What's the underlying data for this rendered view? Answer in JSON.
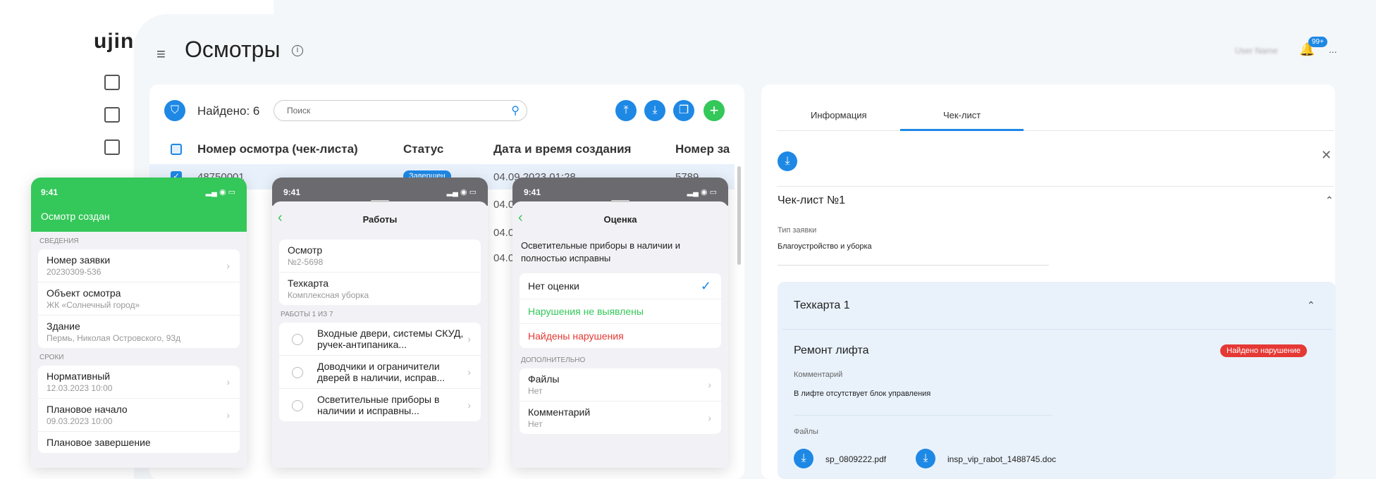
{
  "app": {
    "logo": "ujin",
    "title": "Осмотры",
    "info_icon": "i",
    "user": "User Name",
    "bell_badge": "99+",
    "more": "..."
  },
  "toolbar": {
    "found": "Найдено: 6",
    "search_placeholder": "Поиск"
  },
  "table": {
    "headers": [
      "Номер осмотра (чек-листа)",
      "Статус",
      "Дата и время создания",
      "Номер за"
    ],
    "rows": [
      {
        "num": "48750001",
        "status": "Завершен",
        "date": "04.09.2023 01:28",
        "num2": "5789"
      },
      {
        "date": "04.0"
      },
      {
        "date": "04.0"
      },
      {
        "date": "04.0"
      }
    ]
  },
  "right": {
    "tabs": [
      "Информация",
      "Чек-лист"
    ],
    "checklist_title": "Чек-лист №1",
    "type_label": "Тип заявки",
    "type_value": "Благоустройство и уборка",
    "techcard": "Техкарта 1",
    "item_title": "Ремонт лифта",
    "violation_badge": "Найдено нарушение",
    "comment_label": "Комментарий",
    "comment_value": "В лифте отсутствует блок управления",
    "files_label": "Файлы",
    "files": [
      "sp_0809222.pdf",
      "insp_vip_rabot_1488745.doc"
    ]
  },
  "phone1": {
    "time": "9:41",
    "header": "Осмотр создан",
    "sec1": "СВЕДЕНИЯ",
    "items1": [
      {
        "t": "Номер заявки",
        "s": "20230309-536"
      },
      {
        "t": "Объект осмотра",
        "s": "ЖК «Солнечный город»"
      },
      {
        "t": "Здание",
        "s": "Пермь, Николая Островского, 93д"
      }
    ],
    "sec2": "СРОКИ",
    "items2": [
      {
        "t": "Нормативный",
        "s": "12.03.2023 10:00"
      },
      {
        "t": "Плановое начало",
        "s": "09.03.2023 10:00"
      },
      {
        "t": "Плановое завершение",
        "s": ""
      }
    ]
  },
  "phone2": {
    "time": "9:41",
    "title": "Работы",
    "items1": [
      {
        "t": "Осмотр",
        "s": "№2-5698"
      },
      {
        "t": "Техкарта",
        "s": "Комплексная уборка"
      }
    ],
    "sec": "РАБОТЫ 1 ИЗ 7",
    "works": [
      "Входные двери, системы СКУД, ручек-антипаника...",
      "Доводчики и ограничители дверей в наличии, исправ...",
      "Осветительные приборы в наличии и исправны..."
    ]
  },
  "phone3": {
    "time": "9:41",
    "title": "Оценка",
    "question": "Осветительные приборы в наличии и полностью исправны",
    "options": [
      "Нет оценки",
      "Нарушения не выявлены",
      "Найдены нарушения"
    ],
    "sec": "ДОПОЛНИТЕЛЬНО",
    "items": [
      {
        "t": "Файлы",
        "s": "Нет"
      },
      {
        "t": "Комментарий",
        "s": "Нет"
      }
    ]
  },
  "colors": {
    "accent": "#1e88e5",
    "green": "#34c759",
    "red": "#e53935"
  }
}
